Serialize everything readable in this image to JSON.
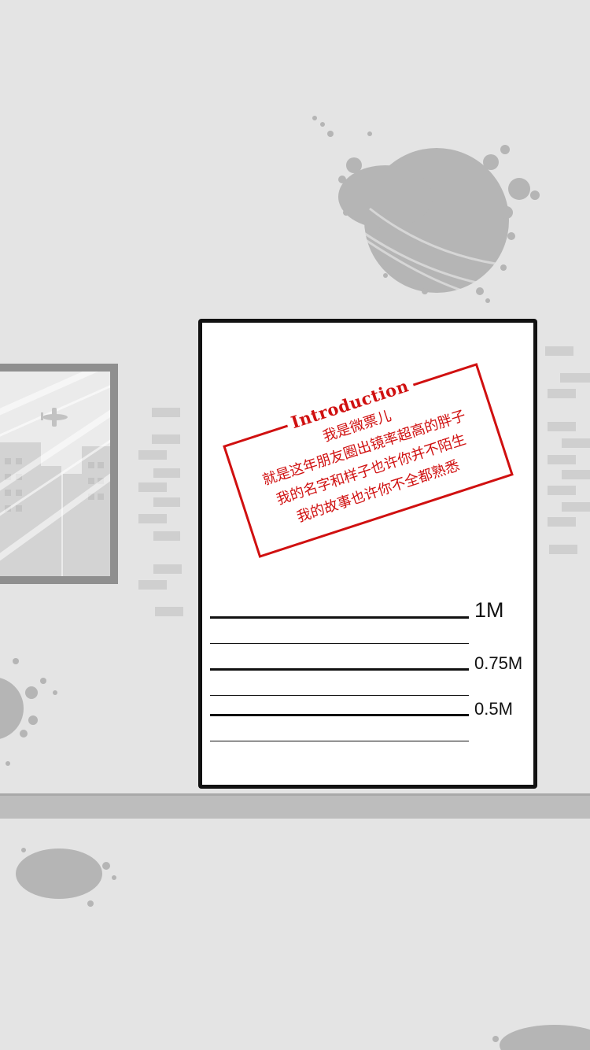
{
  "stamp": {
    "title": "Introduction",
    "lines": [
      "我是微票儿",
      "就是这年朋友圈出镜率超高的胖子",
      "我的名字和样子也许你并不陌生",
      "我的故事也许你不全都熟悉"
    ]
  },
  "ruler": {
    "labels": [
      "1M",
      "0.75M",
      "0.5M"
    ]
  },
  "colors": {
    "background": "#e4e4e4",
    "stamp_red": "#d01010",
    "card_border": "#111111",
    "ink_gray": "#b5b5b5"
  },
  "icons": {
    "plane": "plane-icon",
    "ink_blots": "ink-blot-icon"
  }
}
